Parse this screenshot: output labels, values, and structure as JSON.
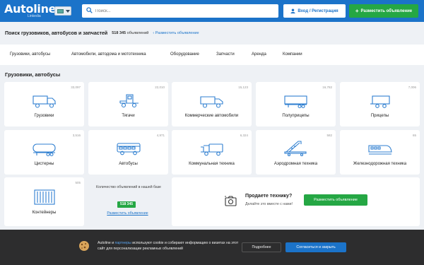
{
  "header": {
    "logo": "Autoline",
    "logo_sub": "Linkedia",
    "search_placeholder": "Поиск...",
    "login_label": "Вход / Регистрация",
    "post_label": "Разместить объявление"
  },
  "page": {
    "title": "Поиск грузовиков, автобусов и запчастей",
    "count_number": "518 345",
    "count_suffix": "объявлений",
    "post_link": "Разместить объявление"
  },
  "nav": {
    "items": [
      "Грузовики, автобусы",
      "Автомобили, автодома и мототехника",
      "Оборудование",
      "Запчасти",
      "Аренда",
      "Компании"
    ]
  },
  "section": {
    "title": "Грузовики, автобусы"
  },
  "categories": [
    {
      "label": "Грузовики",
      "count": "33,097",
      "icon": "truck-icon"
    },
    {
      "label": "Тягачи",
      "count": "22,010",
      "icon": "tractor-unit-icon"
    },
    {
      "label": "Коммерческие автомобили",
      "count": "15,123",
      "icon": "van-icon"
    },
    {
      "label": "Полуприцепы",
      "count": "16,782",
      "icon": "semi-trailer-icon"
    },
    {
      "label": "Прицепы",
      "count": "7,006",
      "icon": "trailer-icon"
    },
    {
      "label": "Цистерны",
      "count": "3,516",
      "icon": "tank-icon"
    },
    {
      "label": "Автобусы",
      "count": "4,971",
      "icon": "bus-icon"
    },
    {
      "label": "Коммунальная техника",
      "count": "6,324",
      "icon": "municipal-icon"
    },
    {
      "label": "Аэродромная техника",
      "count": "582",
      "icon": "airport-stairs-icon"
    },
    {
      "label": "Железнодорожная техника",
      "count": "65",
      "icon": "train-icon"
    },
    {
      "label": "Контейнеры",
      "count": "505",
      "icon": "container-icon"
    }
  ],
  "stats": {
    "text": "Количество объявлений в нашей базе",
    "number": "518 345",
    "link": "Разместить объявление"
  },
  "sell": {
    "title": "Продаете технику?",
    "subtitle": "Делайте это вместе с нами!",
    "button": "Разместить объявление"
  },
  "cookie": {
    "text_pre": "Autoline и",
    "partners": "партнеры",
    "text_post": "используют cookie и собирают информацию о визитах на этот сайт для персонализации рекламных объявлений",
    "more": "Подробнее",
    "agree": "Согласиться и закрыть"
  },
  "colors": {
    "primary": "#1b73c9",
    "accent_green": "#25a744",
    "icon_blue": "#2f7fd0"
  }
}
